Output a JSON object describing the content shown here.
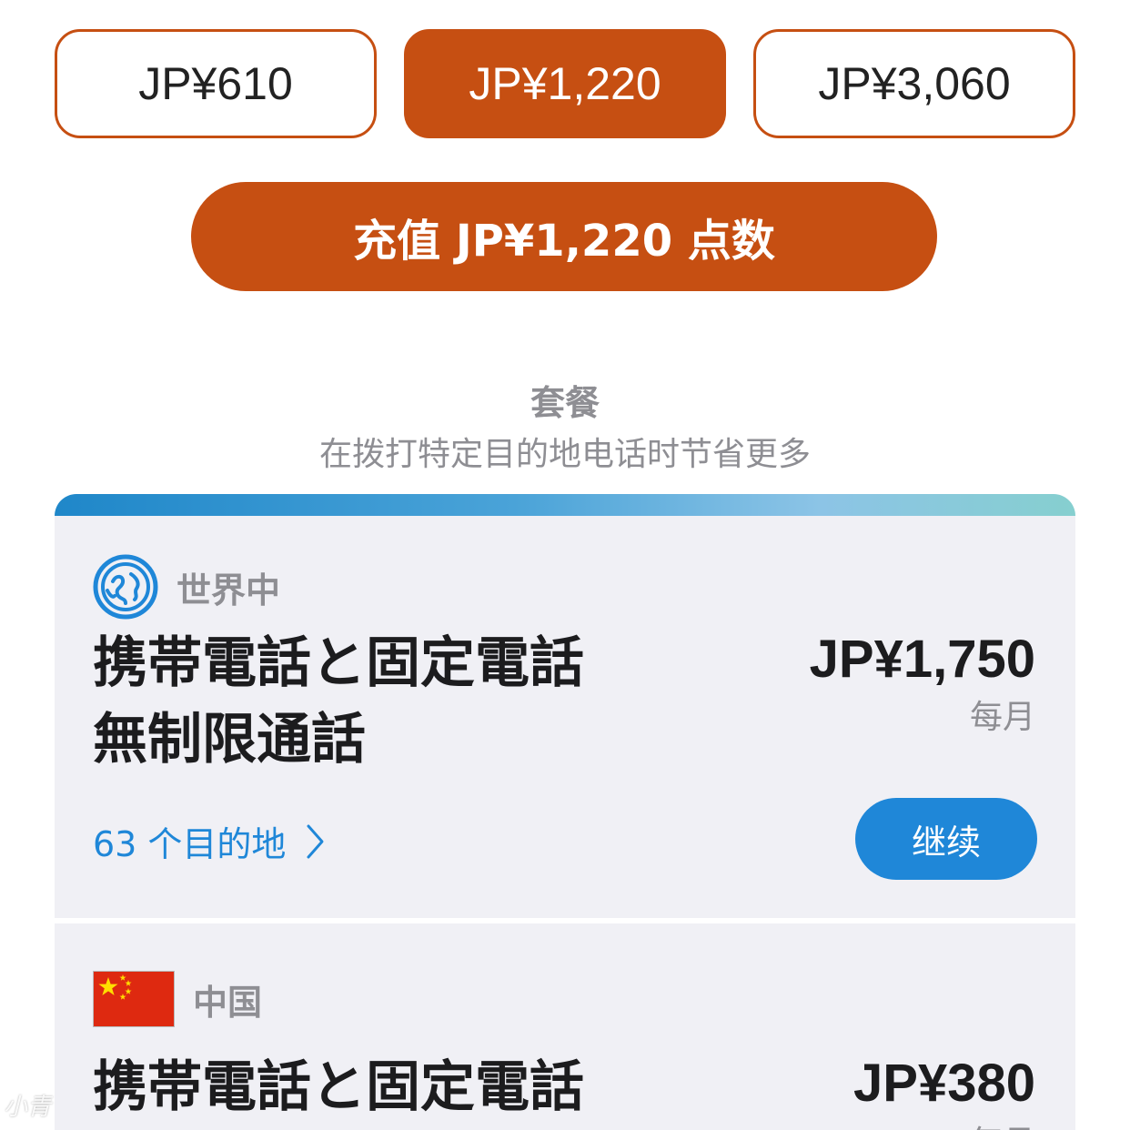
{
  "amounts": {
    "options": [
      {
        "label": "JP¥610",
        "selected": false
      },
      {
        "label": "JP¥1,220",
        "selected": true
      },
      {
        "label": "JP¥3,060",
        "selected": false
      }
    ]
  },
  "topup": {
    "label": "充值 JP¥1,220 点数"
  },
  "packages": {
    "title": "套餐",
    "subtitle": "在拨打特定目的地电话时节省更多",
    "cards": [
      {
        "region": "世界中",
        "region_icon": "globe-icon",
        "name": "携帯電話と固定電話\n無制限通話",
        "price": "JP¥1,750",
        "period": "每月",
        "destinations": "63 个目的地",
        "continue": "继续"
      },
      {
        "region": "中国",
        "region_icon": "china-flag-icon",
        "name": "携帯電話と固定電話",
        "price": "JP¥380",
        "period": "每月"
      }
    ]
  },
  "watermark": "小青",
  "colors": {
    "accent_orange": "#c64f12",
    "link_blue": "#1f87d8",
    "card_bg": "#f0f0f5",
    "muted_text": "#8e8e93",
    "flag_red": "#de2910",
    "flag_yellow": "#ffde00"
  }
}
